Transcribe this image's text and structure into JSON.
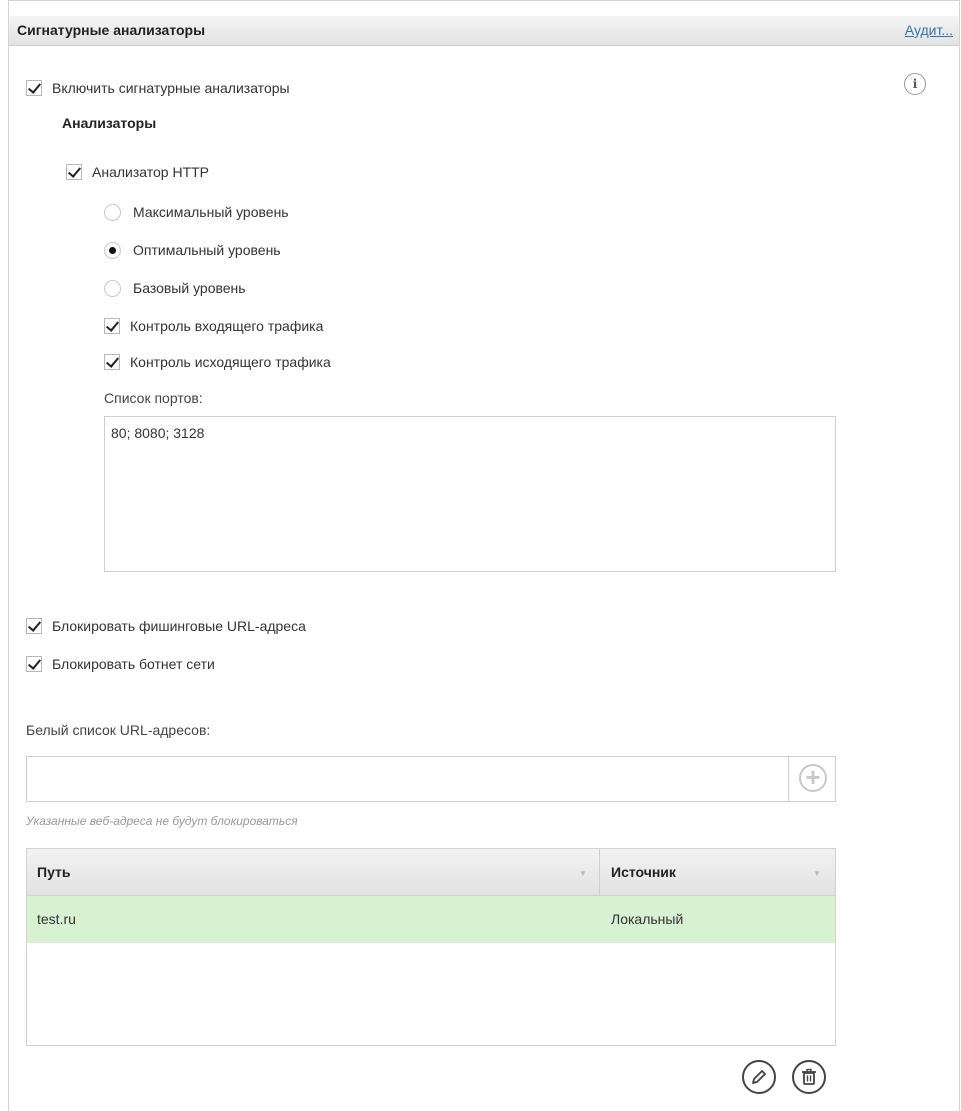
{
  "header": {
    "title": "Сигнатурные анализаторы",
    "audit_link": "Аудит..."
  },
  "info_icon": "i",
  "enable_signature": {
    "label": "Включить сигнатурные анализаторы",
    "checked": true
  },
  "analyzers_heading": "Анализаторы",
  "http_analyzer": {
    "label": "Анализатор HTTP",
    "checked": true
  },
  "levels": [
    {
      "label": "Максимальный уровень",
      "selected": false
    },
    {
      "label": "Оптимальный уровень",
      "selected": true
    },
    {
      "label": "Базовый уровень",
      "selected": false
    }
  ],
  "incoming_traffic": {
    "label": "Контроль входящего трафика",
    "checked": true
  },
  "outgoing_traffic": {
    "label": "Контроль исходящего трафика",
    "checked": true
  },
  "ports": {
    "label": "Список портов:",
    "value": "80; 8080; 3128"
  },
  "block_phishing": {
    "label": "Блокировать фишинговые URL-адреса",
    "checked": true
  },
  "block_botnet": {
    "label": "Блокировать ботнет сети",
    "checked": true
  },
  "whitelist": {
    "label": "Белый список URL-адресов:",
    "input_value": "",
    "hint": "Указанные веб-адреса не будут блокироваться"
  },
  "table": {
    "columns": [
      "Путь",
      "Источник"
    ],
    "rows": [
      {
        "path": "test.ru",
        "source": "Локальный"
      }
    ]
  },
  "icons": {
    "add": "plus-circle-icon",
    "edit": "pencil-icon",
    "delete": "trash-icon",
    "info": "info-icon"
  },
  "colors": {
    "selected_row": "#d7f1d1",
    "link": "#3a6fb5"
  }
}
